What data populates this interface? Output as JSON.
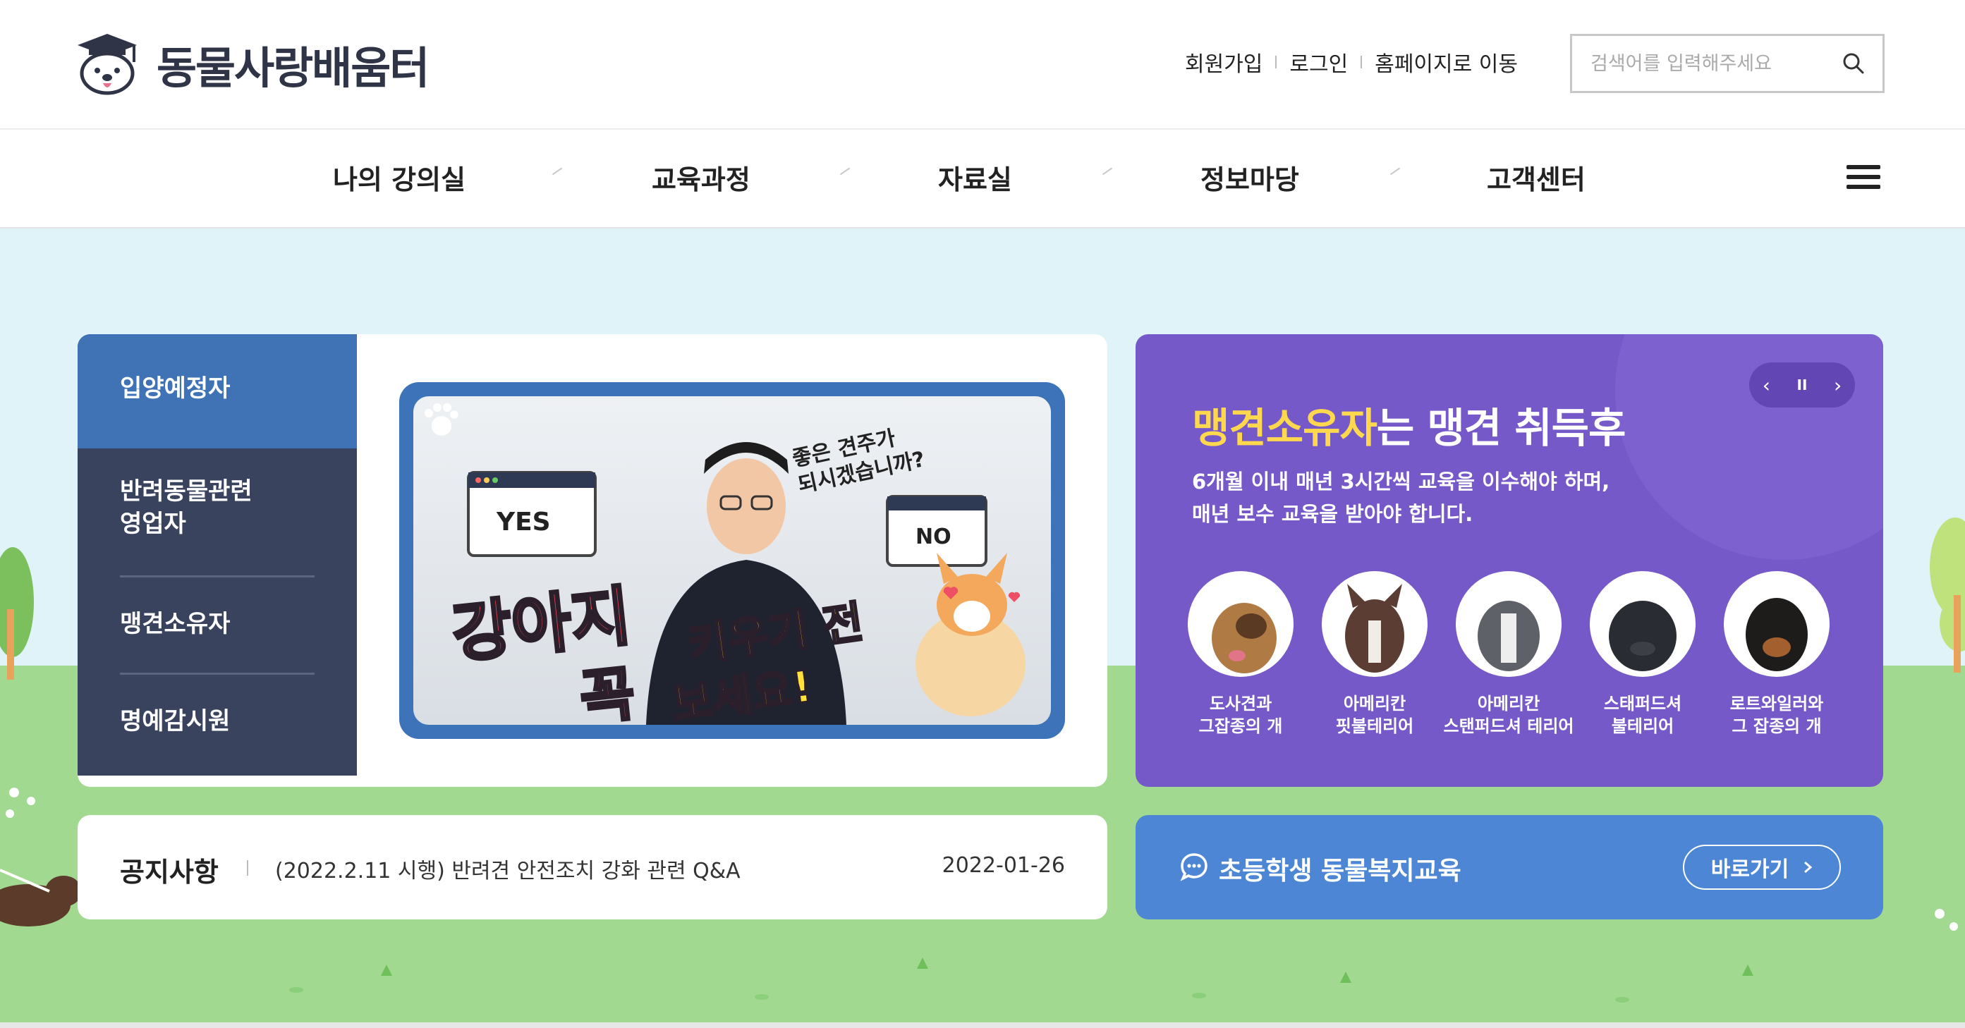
{
  "header": {
    "logo_text": "동물사랑배움터",
    "util_links": [
      "회원가입",
      "로그인",
      "홈페이지로 이동"
    ],
    "search_placeholder": "검색어를 입력해주세요"
  },
  "nav": {
    "items": [
      "나의 강의실",
      "교육과정",
      "자료실",
      "정보마당",
      "고객센터"
    ]
  },
  "side_menu": {
    "items": [
      {
        "line1": "입양예정자",
        "line2": ""
      },
      {
        "line1": "반려동물관련",
        "line2": "영업자"
      },
      {
        "line1": "맹견소유자",
        "line2": ""
      },
      {
        "line1": "명예감시원",
        "line2": ""
      }
    ],
    "active_index": 0
  },
  "video": {
    "yes": "YES",
    "no": "NO",
    "question_line1": "좋은 견주가",
    "question_line2": "되시겠습니까?",
    "headline_a": "강아지",
    "headline_b": "꼭",
    "headline_c": "키우기 전",
    "headline_d": "보세요!"
  },
  "banner": {
    "title_highlight": "맹견소유자",
    "title_rest": "는 맹견 취득후",
    "desc_line1": "6개월 이내 매년 3시간씩 교육을 이수해야 하며,",
    "desc_line2": "매년 보수 교육을 받아야 합니다.",
    "controls": {
      "prev": "‹",
      "pause": "II",
      "next": "›"
    },
    "dogs": [
      {
        "line1": "도사견과",
        "line2": "그잡종의 개"
      },
      {
        "line1": "아메리칸",
        "line2": "핏불테리어"
      },
      {
        "line1": "아메리칸",
        "line2": "스탠퍼드셔 테리어"
      },
      {
        "line1": "스태퍼드셔",
        "line2": "불테리어"
      },
      {
        "line1": "로트와일러와",
        "line2": "그 잡종의 개"
      }
    ]
  },
  "notice": {
    "title": "공지사항",
    "text": "(2022.2.11 시행) 반려견 안전조치 강화 관련 Q&A",
    "date": "2022-01-26"
  },
  "edu": {
    "text": "초등학생 동물복지교육",
    "button": "바로가기"
  },
  "colors": {
    "navy": "#3a435e",
    "active_blue": "#3f73b6",
    "banner_purple": "#7659c9",
    "highlight_yellow": "#ffd84e",
    "edu_blue": "#4c86d4",
    "sky": "#dff3f8",
    "grass": "#a0d98f"
  }
}
